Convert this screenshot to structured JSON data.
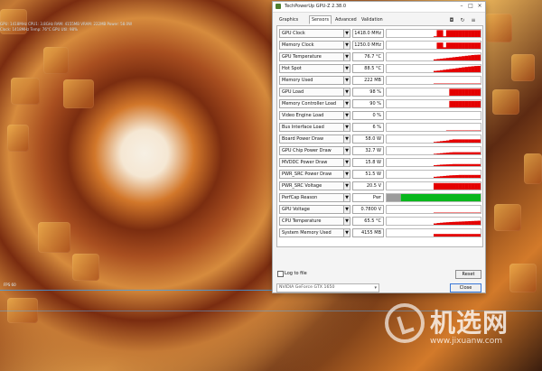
{
  "desktop": {
    "overlay": [
      "GPU: 1418MHz  CPU1: 3.8GHz  RAM: 4155MB  VRAM: 222MB  Power: 58.0W",
      "Clock: 1418MHz  Temp: 76°C  GPU Util: 98%"
    ],
    "side_label": "FPS 60"
  },
  "watermark": {
    "brand": "机选网",
    "url": "www.jixuanw.com"
  },
  "window": {
    "title": "TechPowerUp GPU-Z 2.38.0",
    "controls": {
      "minimize": "–",
      "maximize": "□",
      "close": "×"
    },
    "tabs": [
      "Graphics Card",
      "Sensors",
      "Advanced",
      "Validation"
    ],
    "top_icons": {
      "camera": "◘",
      "refresh": "↻",
      "menu": "≡"
    },
    "sensors": [
      {
        "label": "GPU Clock",
        "value": "1418.0 MHz",
        "graph": [
          0,
          0,
          0,
          0,
          0,
          0,
          0,
          0,
          0,
          0,
          0,
          0,
          0,
          0,
          0,
          0.1,
          0.95,
          0.95,
          0.1,
          0.95,
          0.95,
          0.95,
          0.95,
          0.95,
          0.95,
          0.95,
          0.95,
          0.95,
          0.95,
          0.95
        ]
      },
      {
        "label": "Memory Clock",
        "value": "1250.0 MHz",
        "graph": [
          0,
          0,
          0,
          0,
          0,
          0,
          0,
          0,
          0,
          0,
          0,
          0,
          0,
          0,
          0,
          0,
          0.85,
          0.85,
          0.2,
          0.85,
          0.85,
          0.85,
          0.85,
          0.85,
          0.85,
          0.85,
          0.85,
          0.85,
          0.85,
          0.85
        ]
      },
      {
        "label": "GPU Temperature",
        "value": "76.7 °C",
        "graph": [
          0,
          0,
          0,
          0,
          0,
          0,
          0,
          0,
          0,
          0,
          0,
          0,
          0,
          0,
          0,
          0.15,
          0.2,
          0.25,
          0.3,
          0.35,
          0.4,
          0.45,
          0.5,
          0.55,
          0.6,
          0.65,
          0.7,
          0.75,
          0.78,
          0.8
        ]
      },
      {
        "label": "Hot Spot",
        "value": "88.5 °C",
        "graph": [
          0,
          0,
          0,
          0,
          0,
          0,
          0,
          0,
          0,
          0,
          0,
          0,
          0,
          0,
          0,
          0.18,
          0.22,
          0.28,
          0.34,
          0.4,
          0.45,
          0.5,
          0.56,
          0.62,
          0.68,
          0.73,
          0.78,
          0.82,
          0.86,
          0.88
        ]
      },
      {
        "label": "Memory Used",
        "value": "222 MB",
        "graph": [
          0,
          0,
          0,
          0,
          0,
          0,
          0,
          0,
          0,
          0,
          0,
          0,
          0,
          0,
          0,
          0.02,
          0.02,
          0.02,
          0.02,
          0.02,
          0.02,
          0.02,
          0.02,
          0.02,
          0.02,
          0.02,
          0.02,
          0.02,
          0.02,
          0.02
        ]
      },
      {
        "label": "GPU Load",
        "value": "98 %",
        "graph": [
          0,
          0,
          0,
          0,
          0,
          0,
          0,
          0,
          0,
          0,
          0,
          0,
          0,
          0,
          0,
          0,
          0,
          0,
          0,
          0,
          0.95,
          0.95,
          0.95,
          0.95,
          0.95,
          0.95,
          0.95,
          0.95,
          0.95,
          0.95
        ]
      },
      {
        "label": "Memory Controller Load",
        "value": "90 %",
        "graph": [
          0,
          0,
          0,
          0,
          0,
          0,
          0,
          0,
          0,
          0,
          0,
          0,
          0,
          0,
          0,
          0,
          0,
          0,
          0,
          0,
          0.9,
          0.9,
          0.9,
          0.9,
          0.9,
          0.9,
          0.9,
          0.9,
          0.9,
          0.9
        ]
      },
      {
        "label": "Video Engine Load",
        "value": "0 %",
        "graph": [
          0,
          0,
          0,
          0,
          0,
          0,
          0,
          0,
          0,
          0,
          0,
          0,
          0,
          0,
          0,
          0,
          0,
          0,
          0,
          0,
          0,
          0,
          0,
          0,
          0,
          0,
          0,
          0,
          0,
          0
        ]
      },
      {
        "label": "Bus Interface Load",
        "value": "6 %",
        "graph": [
          0,
          0,
          0,
          0,
          0,
          0,
          0,
          0,
          0,
          0,
          0,
          0,
          0,
          0,
          0,
          0,
          0,
          0,
          0,
          0.05,
          0.06,
          0.06,
          0.06,
          0.06,
          0.06,
          0.06,
          0.06,
          0.06,
          0.06,
          0.06
        ]
      },
      {
        "label": "Board Power Draw",
        "value": "58.0 W",
        "graph": [
          0,
          0,
          0,
          0,
          0,
          0,
          0,
          0,
          0,
          0,
          0,
          0,
          0,
          0,
          0,
          0.1,
          0.15,
          0.2,
          0.25,
          0.3,
          0.4,
          0.45,
          0.45,
          0.45,
          0.45,
          0.45,
          0.45,
          0.45,
          0.45,
          0.45
        ]
      },
      {
        "label": "GPU Chip Power Draw",
        "value": "32.7 W",
        "graph": [
          0,
          0,
          0,
          0,
          0,
          0,
          0,
          0,
          0,
          0,
          0,
          0,
          0,
          0,
          0,
          0.08,
          0.12,
          0.16,
          0.2,
          0.24,
          0.28,
          0.3,
          0.3,
          0.3,
          0.3,
          0.3,
          0.3,
          0.3,
          0.3,
          0.3
        ]
      },
      {
        "label": "MVDDC Power Draw",
        "value": "15.8 W",
        "graph": [
          0,
          0,
          0,
          0,
          0,
          0,
          0,
          0,
          0,
          0,
          0,
          0,
          0,
          0,
          0,
          0.12,
          0.16,
          0.2,
          0.22,
          0.24,
          0.26,
          0.28,
          0.28,
          0.28,
          0.28,
          0.28,
          0.28,
          0.28,
          0.28,
          0.28
        ]
      },
      {
        "label": "PWR_SRC Power Draw",
        "value": "51.5 W",
        "graph": [
          0,
          0,
          0,
          0,
          0,
          0,
          0,
          0,
          0,
          0,
          0,
          0,
          0,
          0,
          0,
          0.14,
          0.18,
          0.22,
          0.26,
          0.3,
          0.34,
          0.36,
          0.38,
          0.4,
          0.4,
          0.4,
          0.4,
          0.4,
          0.4,
          0.4
        ]
      },
      {
        "label": "PWR_SRC Voltage",
        "value": "20.5 V",
        "graph": [
          0,
          0,
          0,
          0,
          0,
          0,
          0,
          0,
          0,
          0,
          0,
          0,
          0,
          0,
          0,
          0.9,
          0.9,
          0.9,
          0.9,
          0.9,
          0.9,
          0.9,
          0.9,
          0.9,
          0.9,
          0.9,
          0.9,
          0.9,
          0.9,
          0.9
        ]
      },
      {
        "label": "PerfCap Reason",
        "value": "Pwr",
        "graph": [
          0,
          0,
          0,
          0,
          0,
          0,
          0,
          0,
          0,
          0,
          0,
          0,
          0,
          0,
          0,
          0,
          0,
          0,
          0,
          0,
          0,
          0,
          0,
          0,
          0,
          0,
          0,
          0,
          0,
          0
        ]
      },
      {
        "label": "GPU Voltage",
        "value": "0.7800 V",
        "graph": [
          0,
          0,
          0,
          0,
          0,
          0,
          0,
          0,
          0,
          0,
          0,
          0,
          0,
          0,
          0,
          0.02,
          0.02,
          0.02,
          0.02,
          0.02,
          0.02,
          0.02,
          0.02,
          0.02,
          0.02,
          0.02,
          0.02,
          0.02,
          0.02,
          0.02
        ]
      },
      {
        "label": "CPU Temperature",
        "value": "65.5 °C",
        "graph": [
          0,
          0,
          0,
          0,
          0,
          0,
          0,
          0,
          0,
          0,
          0,
          0,
          0,
          0,
          0,
          0.18,
          0.24,
          0.28,
          0.32,
          0.35,
          0.38,
          0.4,
          0.42,
          0.44,
          0.46,
          0.48,
          0.5,
          0.52,
          0.54,
          0.56
        ]
      },
      {
        "label": "System Memory Used",
        "value": "4155 MB",
        "graph": [
          0,
          0,
          0,
          0,
          0,
          0,
          0,
          0,
          0,
          0,
          0,
          0,
          0,
          0,
          0,
          0.35,
          0.35,
          0.35,
          0.35,
          0.35,
          0.35,
          0.35,
          0.35,
          0.35,
          0.35,
          0.35,
          0.35,
          0.35,
          0.35,
          0.35
        ]
      }
    ],
    "log_to_file_label": "Log to file",
    "reset_label": "Reset",
    "gpu_selected": "NVIDIA GeForce GTX 1650",
    "close_label": "Close",
    "colors": {
      "graph_red": "#e40000",
      "graph_green": "#08b71d",
      "graph_gray": "#9c9c9c"
    }
  }
}
